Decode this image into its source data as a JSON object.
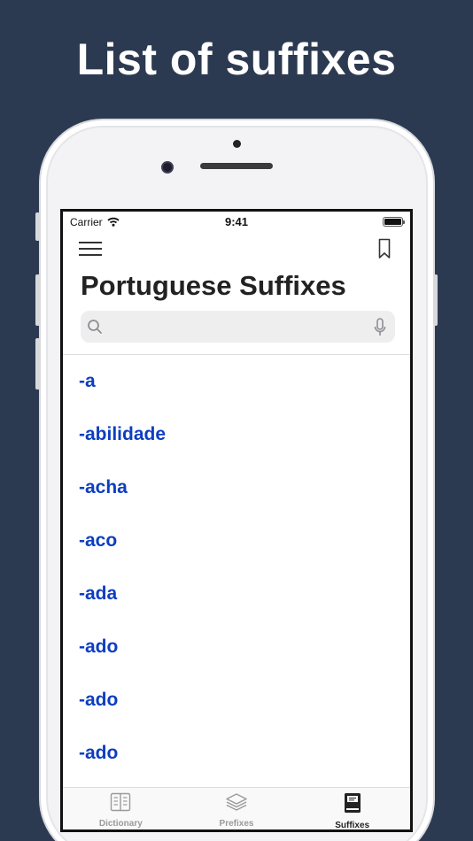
{
  "headline": "List of suffixes",
  "status_bar": {
    "carrier": "Carrier",
    "time": "9:41"
  },
  "header": {
    "title": "Portuguese Suffixes"
  },
  "search": {
    "placeholder": "",
    "value": ""
  },
  "suffixes": [
    "-a",
    "-abilidade",
    "-acha",
    "-aco",
    "-ada",
    "-ado",
    "-ado",
    "-ado"
  ],
  "tabs": [
    {
      "label": "Dictionary",
      "icon": "book-columns-icon",
      "active": false
    },
    {
      "label": "Prefixes",
      "icon": "layers-icon",
      "active": false
    },
    {
      "label": "Suffixes",
      "icon": "book-icon",
      "active": true
    }
  ],
  "colors": {
    "background": "#2c3a51",
    "link": "#0d3ec0",
    "tab_active": "#222222",
    "tab_inactive": "#9a9a9a"
  }
}
